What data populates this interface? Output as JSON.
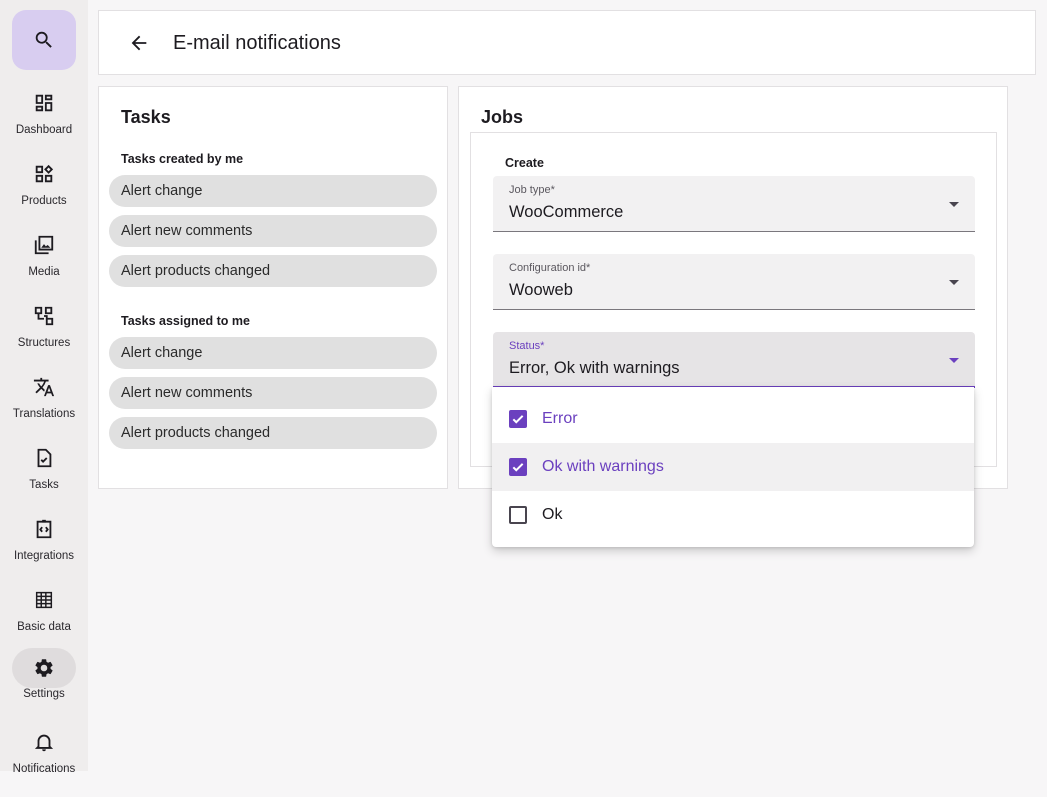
{
  "nav": {
    "items": [
      {
        "label": "Dashboard",
        "icon": "dashboard-icon"
      },
      {
        "label": "Products",
        "icon": "products-icon"
      },
      {
        "label": "Media",
        "icon": "media-icon"
      },
      {
        "label": "Structures",
        "icon": "structures-icon"
      },
      {
        "label": "Translations",
        "icon": "translate-icon"
      },
      {
        "label": "Tasks",
        "icon": "tasks-icon"
      },
      {
        "label": "Integrations",
        "icon": "integrations-icon"
      },
      {
        "label": "Basic data",
        "icon": "basic-data-icon"
      },
      {
        "label": "Settings",
        "icon": "gear-icon",
        "active": true
      },
      {
        "label": "Notifications",
        "icon": "bell-icon"
      }
    ]
  },
  "header": {
    "title": "E-mail notifications"
  },
  "tasks": {
    "title": "Tasks",
    "created_title": "Tasks created by me",
    "created": [
      "Alert change",
      "Alert new comments",
      "Alert products changed"
    ],
    "assigned_title": "Tasks assigned to me",
    "assigned": [
      "Alert change",
      "Alert new comments",
      "Alert products changed"
    ]
  },
  "jobs": {
    "title": "Jobs",
    "create_label": "Create",
    "job_type": {
      "label": "Job type*",
      "value": "WooCommerce"
    },
    "configuration": {
      "label": "Configuration id*",
      "value": "Wooweb"
    },
    "status": {
      "label": "Status*",
      "value": "Error, Ok with warnings"
    },
    "status_options": [
      {
        "label": "Error",
        "checked": true
      },
      {
        "label": "Ok with warnings",
        "checked": true
      },
      {
        "label": "Ok",
        "checked": false
      }
    ]
  },
  "colors": {
    "accent": "#6b40bf",
    "search_bg": "#d8cdf0"
  }
}
